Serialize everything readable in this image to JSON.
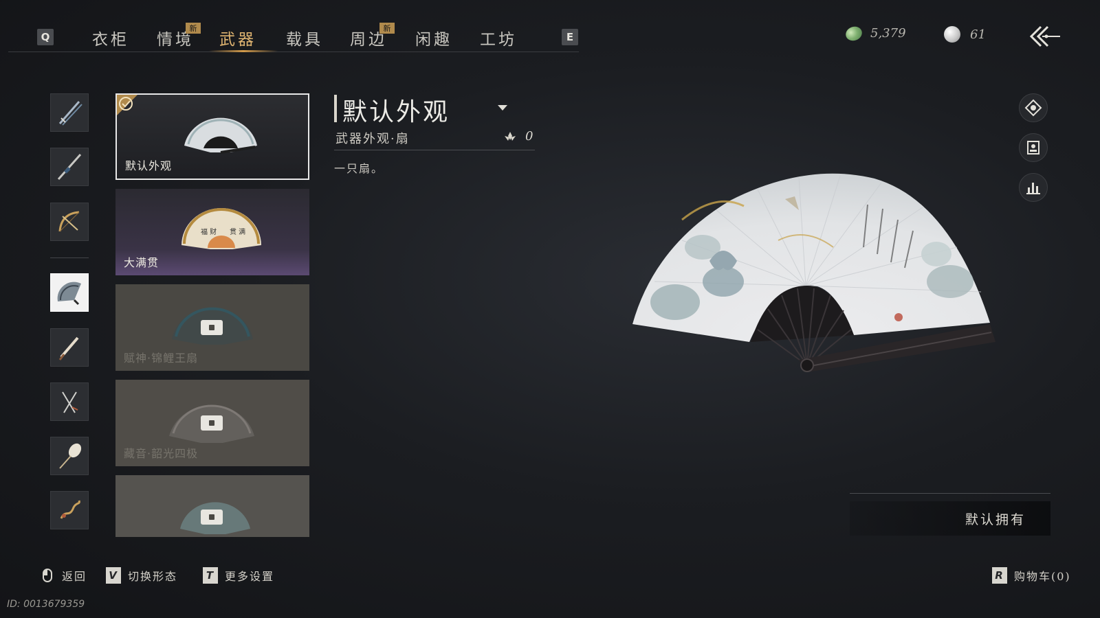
{
  "nav": {
    "prev_key": "Q",
    "next_key": "E",
    "tabs": [
      {
        "label": "衣柜",
        "active": false,
        "new": false
      },
      {
        "label": "情境",
        "active": false,
        "new": true
      },
      {
        "label": "武器",
        "active": true,
        "new": false
      },
      {
        "label": "载具",
        "active": false,
        "new": false
      },
      {
        "label": "周边",
        "active": false,
        "new": true
      },
      {
        "label": "闲趣",
        "active": false,
        "new": false
      },
      {
        "label": "工坊",
        "active": false,
        "new": false
      }
    ],
    "new_badge": "新"
  },
  "currency": {
    "jade": "5,379",
    "pearl": "61"
  },
  "categories": [
    {
      "icon": "sword-icon",
      "selected": false
    },
    {
      "icon": "spear-icon",
      "selected": false
    },
    {
      "icon": "bow-icon",
      "selected": false
    },
    {
      "icon": "fan-icon",
      "selected": true
    },
    {
      "icon": "brush-icon",
      "selected": false
    },
    {
      "icon": "twin-blades-icon",
      "selected": false
    },
    {
      "icon": "umbrella-icon",
      "selected": false
    },
    {
      "icon": "rope-dart-icon",
      "selected": false
    }
  ],
  "skins": [
    {
      "name": "默认外观",
      "state": "selected",
      "equipped": true
    },
    {
      "name": "大满贯",
      "state": "owned"
    },
    {
      "name": "赋神·锦鲤王扇",
      "state": "locked"
    },
    {
      "name": "藏音·韶光四极",
      "state": "locked"
    },
    {
      "name": "",
      "state": "locked"
    }
  ],
  "detail": {
    "title": "默认外观",
    "subtitle": "武器外观·扇",
    "value": "0",
    "description": "一只扇。"
  },
  "owned_label": "默认拥有",
  "hints": {
    "back": "返回",
    "switch_key": "V",
    "switch": "切换形态",
    "settings_key": "T",
    "settings": "更多设置",
    "cart_key": "R",
    "cart": "购物车(0)"
  },
  "id_text": "ID: 0013679359",
  "colors": {
    "accent": "#e0b571",
    "badge": "#b08a4c",
    "background": "#1b1d21"
  }
}
